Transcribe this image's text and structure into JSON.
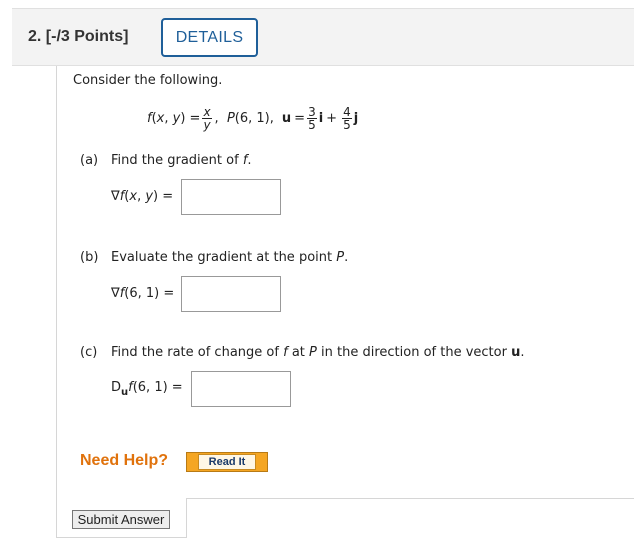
{
  "question": {
    "number_label": "2. [-/3 Points]",
    "details_label": "DETAILS",
    "intro": "Consider the following."
  },
  "function": {
    "f_label": "f(x, y) =",
    "numerator": "x",
    "denominator": "y",
    "point": "P(6, 1),",
    "u_label": "u =",
    "u_i_num": "3",
    "u_i_den": "5",
    "i_sym": "i",
    "plus": "+",
    "u_j_num": "4",
    "u_j_den": "5",
    "j_sym": "j"
  },
  "parts": {
    "a": {
      "label": "(a)",
      "prompt_before": "Find the gradient of",
      "prompt_var": "f",
      "prompt_after": ".",
      "answer_label": "∇f(x, y) =",
      "value": ""
    },
    "b": {
      "label": "(b)",
      "prompt_before": "Evaluate the gradient at the point",
      "prompt_var": "P",
      "prompt_after": ".",
      "answer_label": "∇f(6, 1) =",
      "value": ""
    },
    "c": {
      "label": "(c)",
      "prompt_1": "Find the rate of change of",
      "prompt_f": "f",
      "prompt_2": "at",
      "prompt_p": "P",
      "prompt_3": "in the direction of the vector",
      "prompt_u": "u",
      "prompt_end": ".",
      "ans_d": "D",
      "ans_sub": "u",
      "ans_rest": "f(6, 1) =",
      "value": ""
    }
  },
  "help": {
    "need_help": "Need Help?",
    "read_it": "Read It"
  },
  "submit_label": "Submit Answer"
}
